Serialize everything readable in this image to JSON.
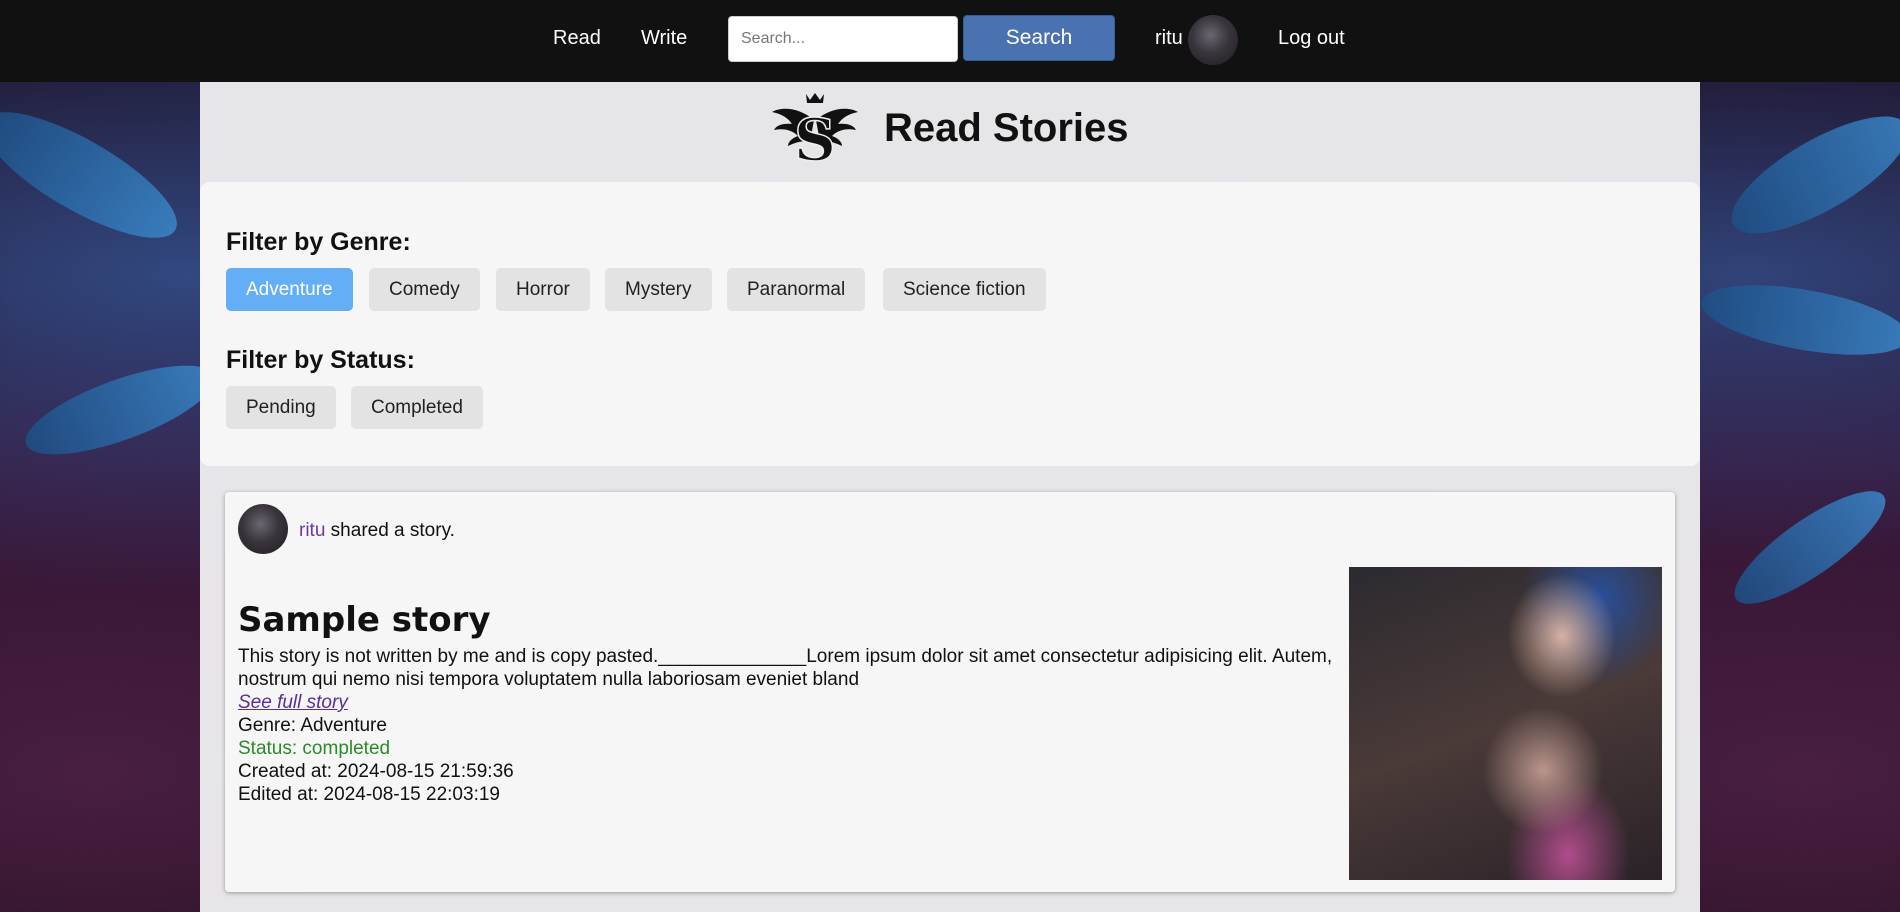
{
  "nav": {
    "read_label": "Read",
    "write_label": "Write",
    "search_placeholder": "Search...",
    "search_button_label": "Search",
    "username": "ritu",
    "logout_label": "Log out"
  },
  "header": {
    "title": "Read Stories"
  },
  "filters": {
    "genre_heading": "Filter by Genre:",
    "genres": [
      "Adventure",
      "Comedy",
      "Horror",
      "Mystery",
      "Paranormal",
      "Science fiction"
    ],
    "active_genre": "Adventure",
    "status_heading": "Filter by Status:",
    "statuses": [
      "Pending",
      "Completed"
    ]
  },
  "story": {
    "author": "ritu",
    "shared_text": " shared a story.",
    "title": "Sample story",
    "excerpt": "This story is not written by me and is copy pasted.______________Lorem ipsum dolor sit amet consectetur adipisicing elit. Autem, nostrum qui nemo nisi tempora voluptatem nulla laboriosam eveniet bland",
    "see_full_label": "See full story",
    "genre_line": "Genre: Adventure",
    "status_line": "Status: completed",
    "created_line": "Created at: 2024-08-15 21:59:36",
    "edited_line": "Edited at: 2024-08-15 22:03:19"
  },
  "colors": {
    "navbar": "#111111",
    "search_button": "#4a72b0",
    "active_chip": "#64aef5",
    "status_completed": "#2a8a2a",
    "link_visited": "#5a2d99"
  }
}
